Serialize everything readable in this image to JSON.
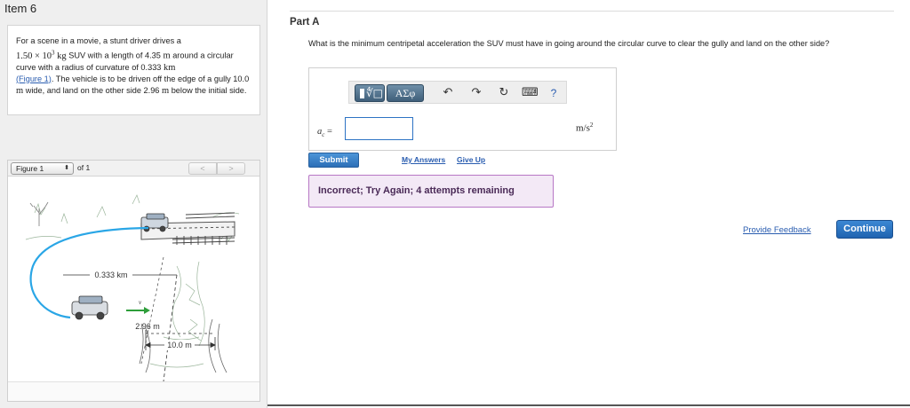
{
  "item": {
    "title": "Item 6"
  },
  "problem": {
    "t1": "For a scene in a movie, a stunt driver drives a",
    "mass": "1.50 × 10",
    "mass_exp": "3",
    "mass_unit": " kg",
    "t2": " SUV with a length of 4.35 ",
    "len_unit": "m",
    "t3": " around a circular curve with a radius of curvature of 0.333 ",
    "rad_unit": "km",
    "figure_link": "(Figure 1)",
    "t4": ". The vehicle is to be driven off the edge of a gully 10.0 ",
    "m1": "m",
    "t5": " wide, and land on the other side 2.96 ",
    "m2": "m",
    "t6": " below the initial side."
  },
  "figure": {
    "selected": "Figure 1",
    "of_label": "of 1",
    "prev": "<",
    "next": ">",
    "labels": {
      "radius": "0.333 km",
      "height": "2.96 m",
      "width": "10.0 m",
      "v": "v"
    }
  },
  "part": {
    "title": "Part A",
    "question": "What is the minimum centripetal acceleration the SUV must have in going around the circular curve to clear the gully and land on the other side?"
  },
  "answer": {
    "toolbar": {
      "templates_icon": "templates-icon",
      "greek_label": "ΑΣφ",
      "undo_icon": "undo-icon",
      "redo_icon": "redo-icon",
      "reset_icon": "reset-icon",
      "keyboard_icon": "keyboard-icon",
      "help_label": "?"
    },
    "var_label": "a",
    "var_sub": "c",
    "var_eq": " =",
    "input_value": "",
    "unit_base": "m/s",
    "unit_exp": "2"
  },
  "actions": {
    "submit": "Submit",
    "my_answers": "My Answers",
    "give_up": "Give Up"
  },
  "feedback": {
    "message": "Incorrect; Try Again; 4 attempts remaining"
  },
  "footer": {
    "provide_feedback": "Provide Feedback",
    "continue": "Continue"
  },
  "colors": {
    "accent_blue": "#2c6fb7",
    "link_blue": "#2a5db0",
    "feedback_bg": "#f3e9f6",
    "feedback_border": "#b777c5",
    "curve_blue": "#2aa6e6",
    "arrow_green": "#2e9e3a"
  }
}
